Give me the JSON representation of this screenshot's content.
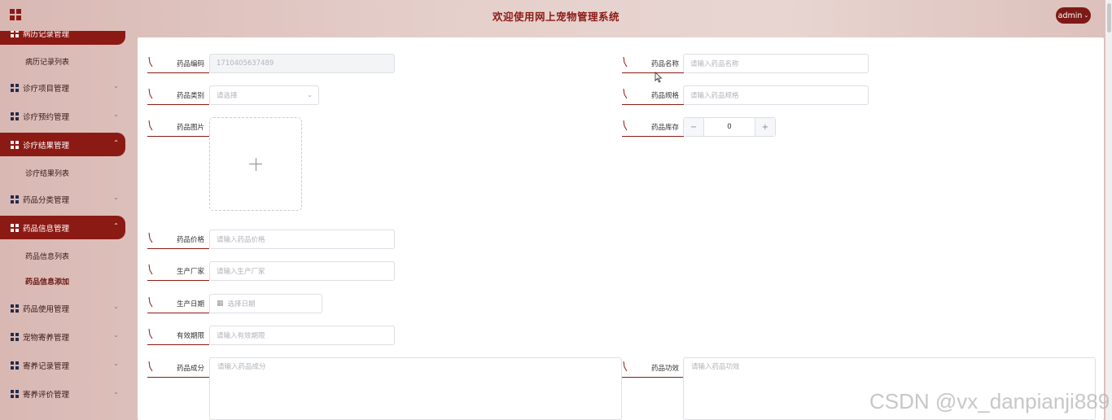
{
  "header": {
    "title": "欢迎使用网上宠物管理系统",
    "user": "admin"
  },
  "colors": {
    "accent": "#8b1a14",
    "sidebar_bg": "#dcc0bb"
  },
  "icons": {
    "logo": "grid-icon",
    "menu": "grid-icon",
    "pin": "pin-icon"
  },
  "sidebar": {
    "items": [
      {
        "label": "病历记录管理",
        "active": true
      },
      {
        "label": "病历记录列表",
        "sub": true
      },
      {
        "label": "诊疗项目管理",
        "active": false
      },
      {
        "label": "诊疗预约管理",
        "active": false
      },
      {
        "label": "诊疗结果管理",
        "active": true
      },
      {
        "label": "诊疗结果列表",
        "sub": true
      },
      {
        "label": "药品分类管理",
        "active": false
      },
      {
        "label": "药品信息管理",
        "active": true
      },
      {
        "label": "药品信息列表",
        "sub": true
      },
      {
        "label": "药品信息添加",
        "sub": true,
        "current": true
      },
      {
        "label": "药品使用管理",
        "active": false
      },
      {
        "label": "宠物寄养管理",
        "active": false
      },
      {
        "label": "寄养记录管理",
        "active": false
      },
      {
        "label": "寄养评价管理",
        "active": false
      }
    ]
  },
  "form": {
    "code": {
      "label": "药品编码",
      "value": "1710405637489"
    },
    "name": {
      "label": "药品名称",
      "placeholder": "请输入药品名称"
    },
    "category": {
      "label": "药品类别",
      "placeholder": "请选择"
    },
    "spec": {
      "label": "药品规格",
      "placeholder": "请输入药品规格"
    },
    "image": {
      "label": "药品图片"
    },
    "stock": {
      "label": "药品库存",
      "value": "0",
      "minus": "−",
      "plus": "+"
    },
    "price": {
      "label": "药品价格",
      "placeholder": "请输入药品价格"
    },
    "maker": {
      "label": "生产厂家",
      "placeholder": "请输入生产厂家"
    },
    "date": {
      "label": "生产日期",
      "placeholder": "选择日期"
    },
    "expiry": {
      "label": "有效期限",
      "placeholder": "请输入有效期限"
    },
    "ingredients": {
      "label": "药品成分",
      "placeholder": "请输入药品成分"
    },
    "efficacy": {
      "label": "药品功效",
      "placeholder": "请输入药品功效"
    }
  },
  "watermark": "CSDN @vx_danpianji889"
}
